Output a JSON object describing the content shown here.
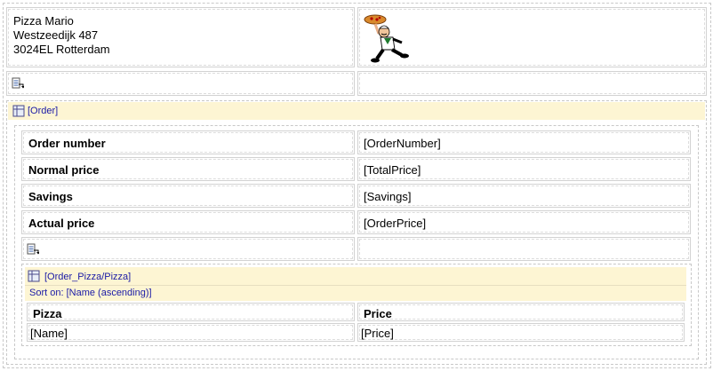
{
  "header": {
    "address": [
      "Pizza Mario",
      "Westzeedijk 487",
      "3024EL Rotterdam"
    ],
    "logo_icon": "pizza-chef-logo"
  },
  "order_section": {
    "title": "[Order]",
    "rows": [
      {
        "label": "Order number",
        "value": "[OrderNumber]"
      },
      {
        "label": "Normal price",
        "value": "[TotalPrice]"
      },
      {
        "label": "Savings",
        "value": "[Savings]"
      },
      {
        "label": "Actual price",
        "value": "[OrderPrice]"
      }
    ]
  },
  "pizza_section": {
    "title": "[Order_Pizza/Pizza]",
    "sort": "Sort on: [Name (ascending)]",
    "columns": [
      "Pizza",
      "Price"
    ],
    "row": [
      "[Name]",
      "[Price]"
    ]
  },
  "colors": {
    "link": "#1a1aa6",
    "header_bg": "#fdf5d3"
  }
}
